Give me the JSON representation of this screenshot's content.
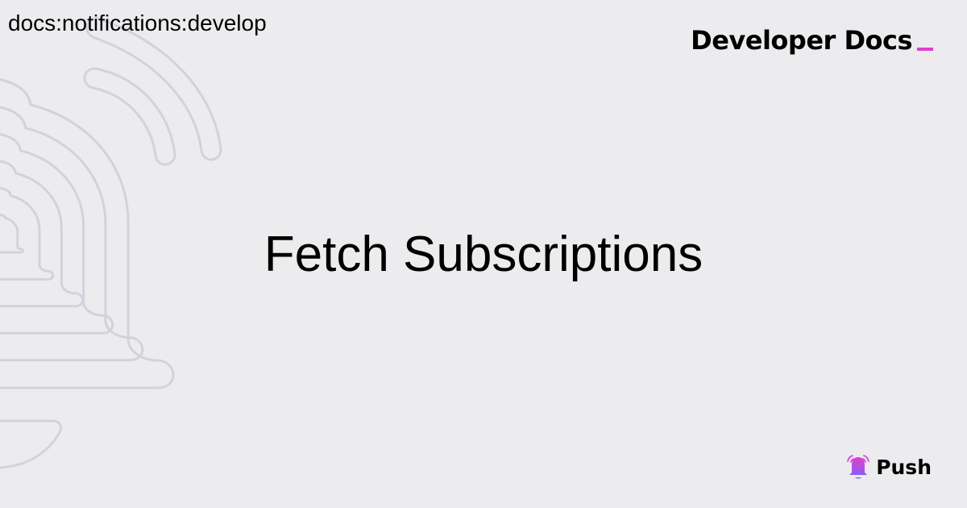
{
  "breadcrumb": "docs:notifications:develop",
  "brand": {
    "label": "Developer Docs",
    "cursor_color": "#E040C8"
  },
  "title": "Fetch Subscriptions",
  "logo": {
    "name": "Push",
    "icon": "bell-icon",
    "gradient": [
      "#E040C8",
      "#8B5CF6"
    ]
  },
  "colors": {
    "background": "#ECECEE",
    "decoration": "#D3D2DC"
  }
}
